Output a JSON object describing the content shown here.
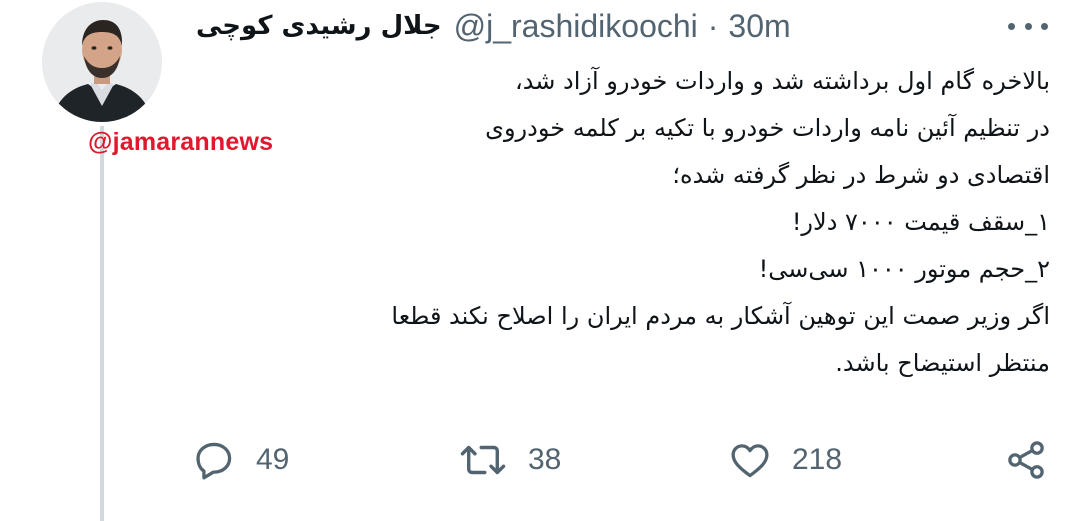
{
  "tweet": {
    "author": {
      "display_name": "جلال رشیدی کوچی",
      "handle": "@j_rashidikoochi",
      "avatar_icon": "profile-photo"
    },
    "separator": "·",
    "timestamp": "30m",
    "more_icon": "more-icon",
    "watermark": "@jamarannews",
    "lines": [
      "بالاخره گام اول برداشته شد و واردات خودرو آزاد شد،",
      "در تنظیم آئین نامه واردات خودرو با تکیه بر کلمه خودروی",
      "اقتصادی دو شرط در نظر گرفته شده؛",
      "۱_سقف قیمت ۷۰۰۰ دلار!",
      "۲_حجم موتور ۱۰۰۰ سی‌سی!",
      "اگر وزیر صمت این توهین آشکار به مردم ایران را اصلاح نکند قطعا",
      "منتظر استیضاح باشد."
    ],
    "actions": {
      "reply": {
        "icon": "reply-icon",
        "count": "49"
      },
      "retweet": {
        "icon": "retweet-icon",
        "count": "38"
      },
      "like": {
        "icon": "like-icon",
        "count": "218"
      },
      "share": {
        "icon": "share-icon"
      }
    },
    "colors": {
      "text": "#0f1419",
      "secondary": "#536471",
      "watermark": "#e0182d",
      "thread_line": "#cfd9de"
    }
  }
}
